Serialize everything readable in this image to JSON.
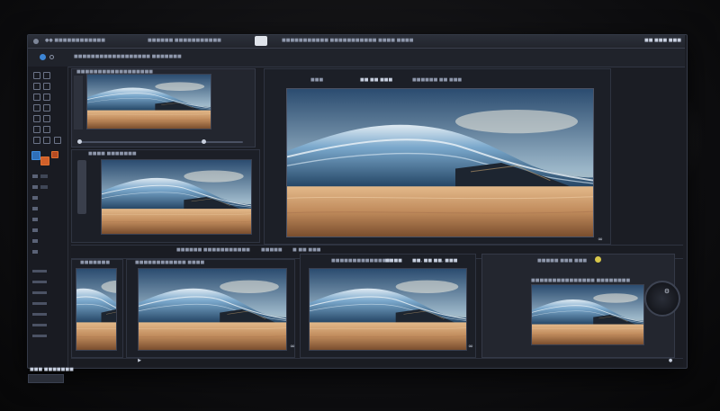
{
  "window": {
    "title_left": "●● ■■■■■■■■■■■■",
    "title_center": "■■■■■■ ■■■■■■■■■■■",
    "title_right": "■■■■■■■■■■■ ■■■■■■■■■■■ ■■■■ ■■■■",
    "right_controls": "■■ ■■■ ■■■"
  },
  "menu": {
    "left_label": "■■■■■■■■■■■■■■■■■■ ■■■■■■■",
    "viewer_label_1": "■■■",
    "viewer_label_2": "■■ ■■ ■■■",
    "viewer_label_3": "■■■■■■ ■■ ■■■"
  },
  "panels": {
    "top_left_header": "■■■■■■■■■■■■■■■■■■",
    "mid_left_header": "■■■■ ■■■■■■■",
    "timeline_label_1": "■■■■■■ ■■■■■■■■■■■",
    "timeline_label_2": "■■■■■",
    "viewer_status": "■ ■■ ■■■",
    "bottom_header_1": "■■■■■■■",
    "bottom_header_2": "■■■■■■■■■■■■ ■■■■",
    "bottom_header_3": "■■■■■■■■■■■■■■",
    "bottom_header_3b": "■■■■",
    "bottom_header_3c": "■■, ■■ ■■, ■■■",
    "bottom_header_4": "■■■■■ ■■■ ■■■",
    "bottom_header_5": "■■■■■■■■■■■■■■■ ■■■■■■■■",
    "palette_footer": "■■■ ■■■■■■■"
  },
  "icons": {
    "play": "▶",
    "dot": "●",
    "gear": "⚙",
    "link": "∞"
  },
  "colors": {
    "window_bg": "#1b1d24",
    "accent_orange": "#d0602a",
    "accent_blue": "#2f6fb8",
    "sand": "#c08b5c",
    "wave": "#6f9cc4"
  }
}
